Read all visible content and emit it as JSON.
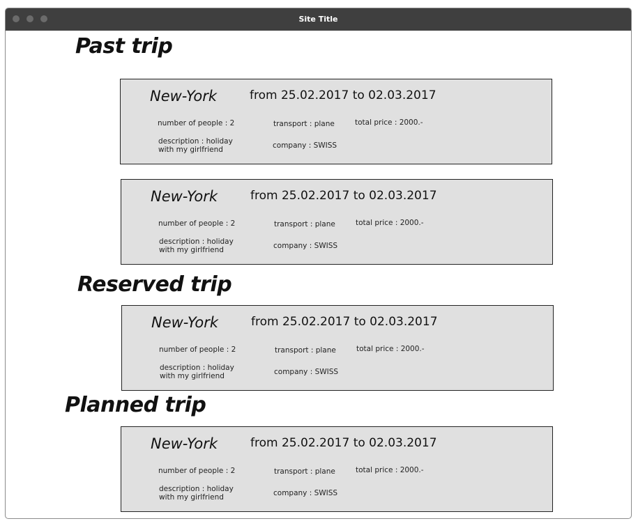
{
  "window": {
    "title": "Site Title"
  },
  "sections": {
    "past": "Past trip",
    "reserved": "Reserved trip",
    "planned": "Planned trip"
  },
  "trips": [
    {
      "city": "New-York",
      "dates": "from 25.02.2017 to 02.03.2017",
      "people": "number of people : 2",
      "transport": "transport : plane",
      "price": "total price : 2000.-",
      "description_line1": "description : holiday",
      "description_line2": "with my girlfriend",
      "company": "company : SWISS"
    },
    {
      "city": "New-York",
      "dates": "from 25.02.2017 to 02.03.2017",
      "people": "number of people : 2",
      "transport": "transport : plane",
      "price": "total price : 2000.-",
      "description_line1": "description : holiday",
      "description_line2": "with my girlfriend",
      "company": "company : SWISS"
    },
    {
      "city": "New-York",
      "dates": "from 25.02.2017 to 02.03.2017",
      "people": "number of people : 2",
      "transport": "transport : plane",
      "price": "total price : 2000.-",
      "description_line1": "description : holiday",
      "description_line2": "with my girlfriend",
      "company": "company : SWISS"
    },
    {
      "city": "New-York",
      "dates": "from 25.02.2017 to 02.03.2017",
      "people": "number of people : 2",
      "transport": "transport : plane",
      "price": "total price : 2000.-",
      "description_line1": "description : holiday",
      "description_line2": "with my girlfriend",
      "company": "company : SWISS"
    }
  ]
}
